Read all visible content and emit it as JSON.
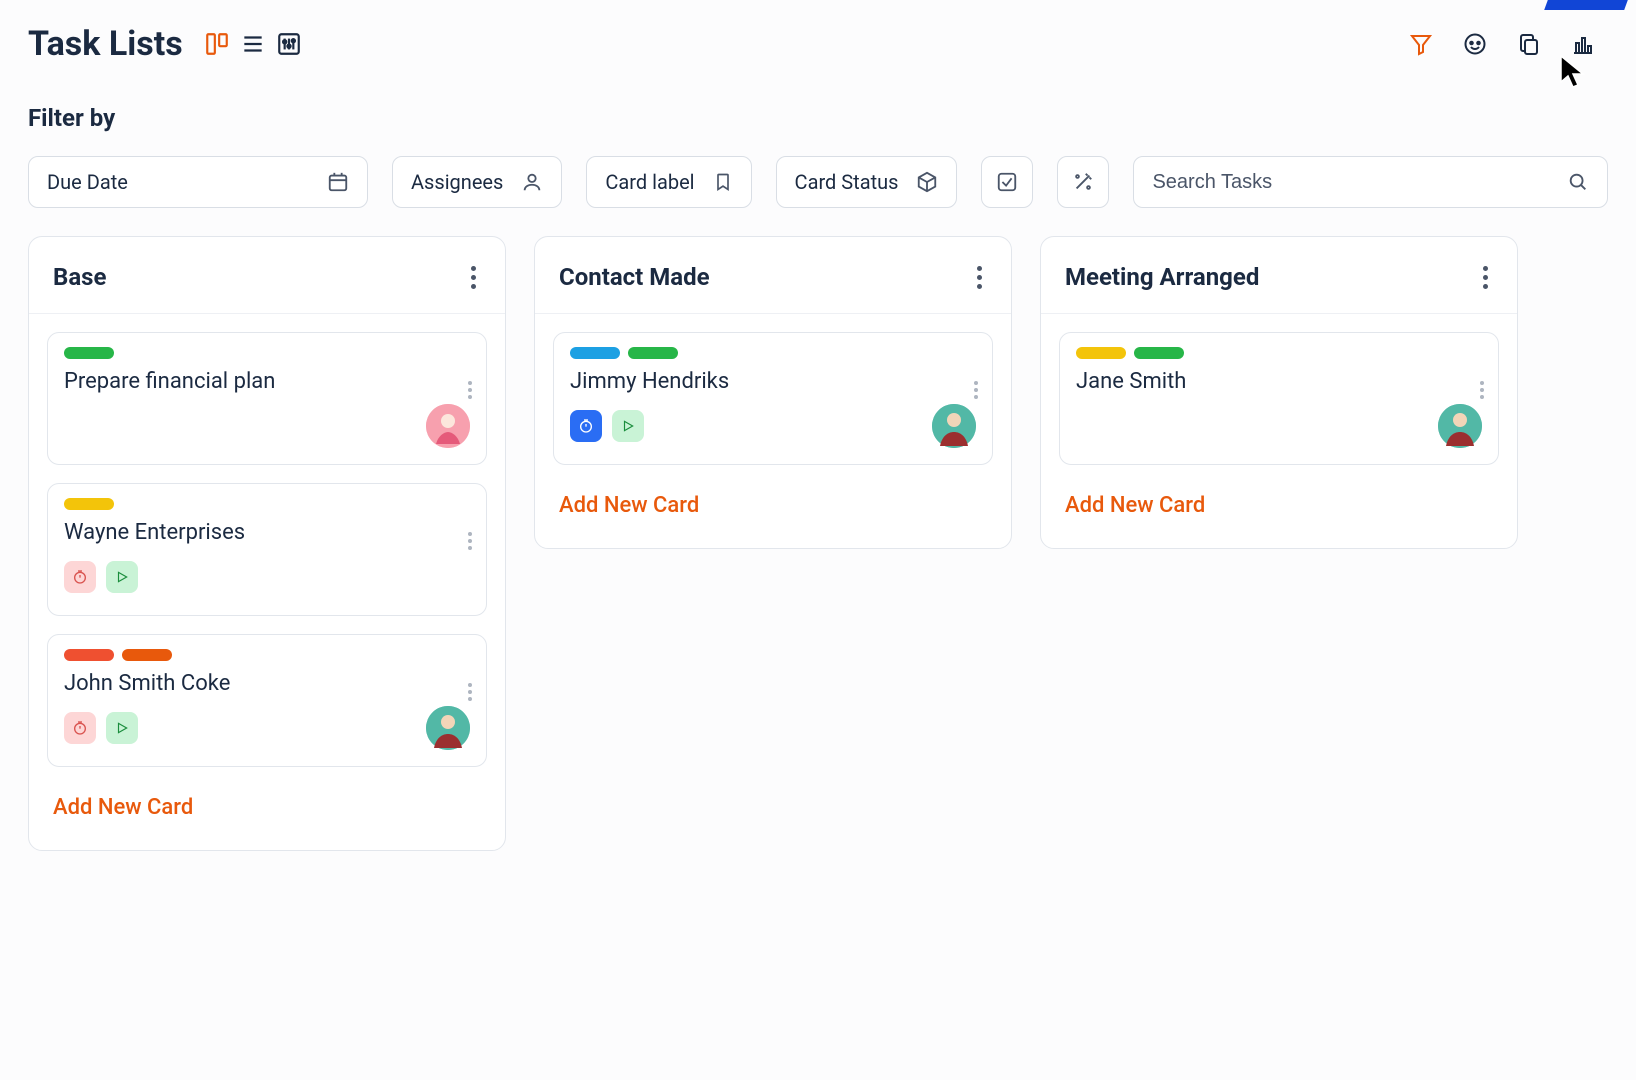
{
  "page": {
    "title": "Task Lists"
  },
  "filters": {
    "heading": "Filter by",
    "due_date": "Due Date",
    "assignees": "Assignees",
    "card_label": "Card label",
    "card_status": "Card Status",
    "search_placeholder": "Search Tasks"
  },
  "columns": [
    {
      "title": "Base",
      "add_label": "Add New Card",
      "cards": [
        {
          "title": "Prepare financial plan",
          "labels": [
            "green"
          ],
          "badges": [],
          "avatar": "pink"
        },
        {
          "title": "Wayne Enterprises",
          "labels": [
            "yellow"
          ],
          "badges": [
            "timer-pink",
            "play"
          ],
          "avatar": null
        },
        {
          "title": "John Smith Coke",
          "labels": [
            "red",
            "orange"
          ],
          "badges": [
            "timer-pink",
            "play"
          ],
          "avatar": "teal"
        }
      ]
    },
    {
      "title": "Contact Made",
      "add_label": "Add New Card",
      "cards": [
        {
          "title": "Jimmy Hendriks",
          "labels": [
            "blue",
            "green"
          ],
          "badges": [
            "timer-blue",
            "play"
          ],
          "avatar": "teal"
        }
      ]
    },
    {
      "title": "Meeting Arranged",
      "add_label": "Add New Card",
      "cards": [
        {
          "title": "Jane Smith",
          "labels": [
            "yellow",
            "green"
          ],
          "badges": [],
          "avatar": "teal"
        }
      ]
    }
  ]
}
